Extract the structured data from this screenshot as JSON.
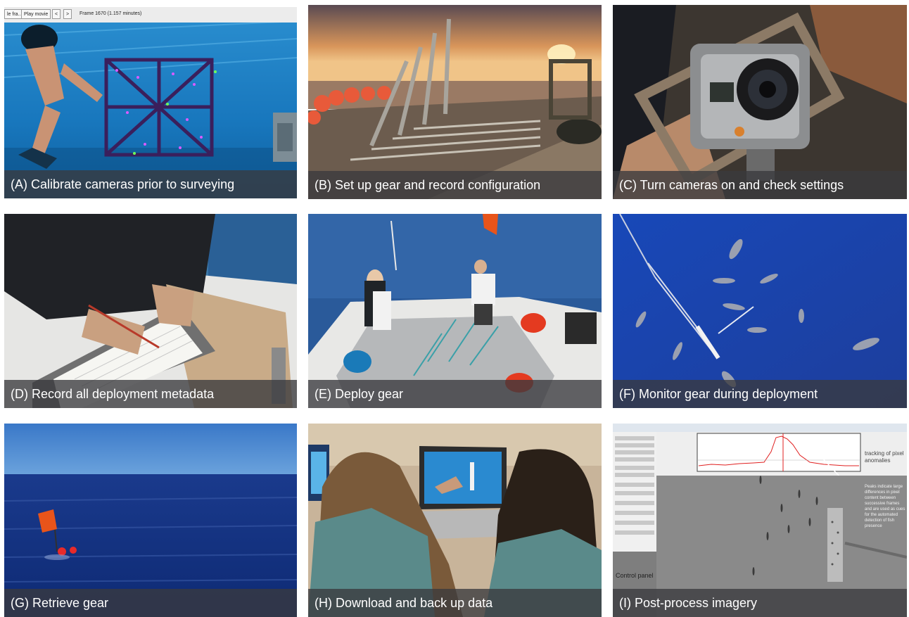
{
  "captions": {
    "a": "(A) Calibrate cameras prior to surveying",
    "b": "(B) Set up gear and record configuration",
    "c": "(C) Turn cameras on and check settings",
    "d": "(D) Record all deployment metadata",
    "e": "(E) Deploy gear",
    "f": "(F) Monitor gear during deployment",
    "g": "(G) Retrieve gear",
    "h": "(H) Download and back up data",
    "i": "(I) Post-process imagery"
  },
  "panel_a_toolbar": {
    "button1": "le fra..",
    "button2": "Play movie",
    "button3": "<",
    "button4": ">",
    "frame_info": "Frame 1670 (1.157 minutes)"
  },
  "panel_i_software": {
    "control_panel_label": "Control panel",
    "tracking_label": "tracking of pixel anomalies",
    "peaks_note": "Peaks indicate large differences in pixel content between successive frames and are used as cues for the automated detection of fish presence"
  },
  "colors": {
    "caption_bar": "#3a3a3e",
    "caption_text": "#ffffff",
    "pool_blue": "#1a88c8",
    "ocean_blue": "#1f47a8",
    "buoy_orange": "#e8541a",
    "plot_red": "#e02020"
  }
}
